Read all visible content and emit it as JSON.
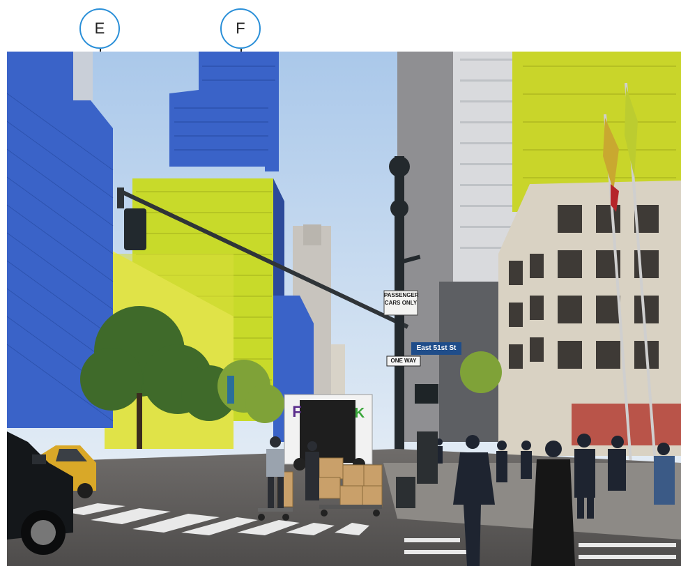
{
  "callouts": [
    {
      "id": "E",
      "label": "E"
    },
    {
      "id": "F",
      "label": "F"
    }
  ],
  "signs": {
    "passenger_line1": "PASSENGER",
    "passenger_line2": "CARS ONLY",
    "street": "East 51st St",
    "one_way": "ONE WAY"
  },
  "truck_text": "F",
  "truck_text2": "K",
  "colors": {
    "highlight_blue": "#3a63c8",
    "highlight_yellow": "#d4e61e",
    "callout_border": "#2a8fd8",
    "sky": "#c9dcf0"
  }
}
